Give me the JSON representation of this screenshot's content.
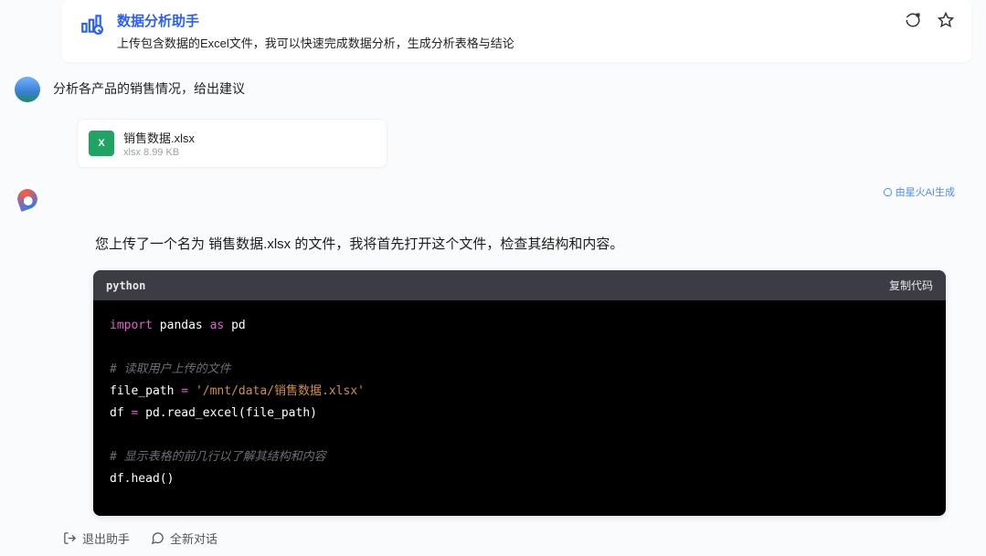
{
  "header": {
    "title": "数据分析助手",
    "description": "上传包含数据的Excel文件，我可以快速完成数据分析，生成分析表格与结论"
  },
  "user_message": {
    "text": "分析各产品的销售情况，给出建议"
  },
  "attachment": {
    "icon_label": "X",
    "name": "销售数据.xlsx",
    "type": "xlsx",
    "size": "8.99 KB"
  },
  "generation_badge": "由星火AI生成",
  "ai_message": {
    "prefix": "您上传了一个名为 ",
    "filename": "销售数据.xlsx",
    "suffix": " 的文件，我将首先打开这个文件，检查其结构和内容。"
  },
  "code": {
    "lang": "python",
    "copy_label": "复制代码",
    "lines": {
      "l1_kw1": "import",
      "l1_id1": " pandas ",
      "l1_kw2": "as",
      "l1_id2": " pd",
      "l3_cmt": "# 读取用户上传的文件",
      "l4_a": "file_path ",
      "l4_op": "=",
      "l4_b": " ",
      "l4_str": "'/mnt/data/销售数据.xlsx'",
      "l5_a": "df ",
      "l5_op": "=",
      "l5_b": " pd.read_excel(file_path)",
      "l7_cmt": "# 显示表格的前几行以了解其结构和内容",
      "l8": "df.head()"
    }
  },
  "footer": {
    "exit": "退出助手",
    "new_chat": "全新对话"
  }
}
